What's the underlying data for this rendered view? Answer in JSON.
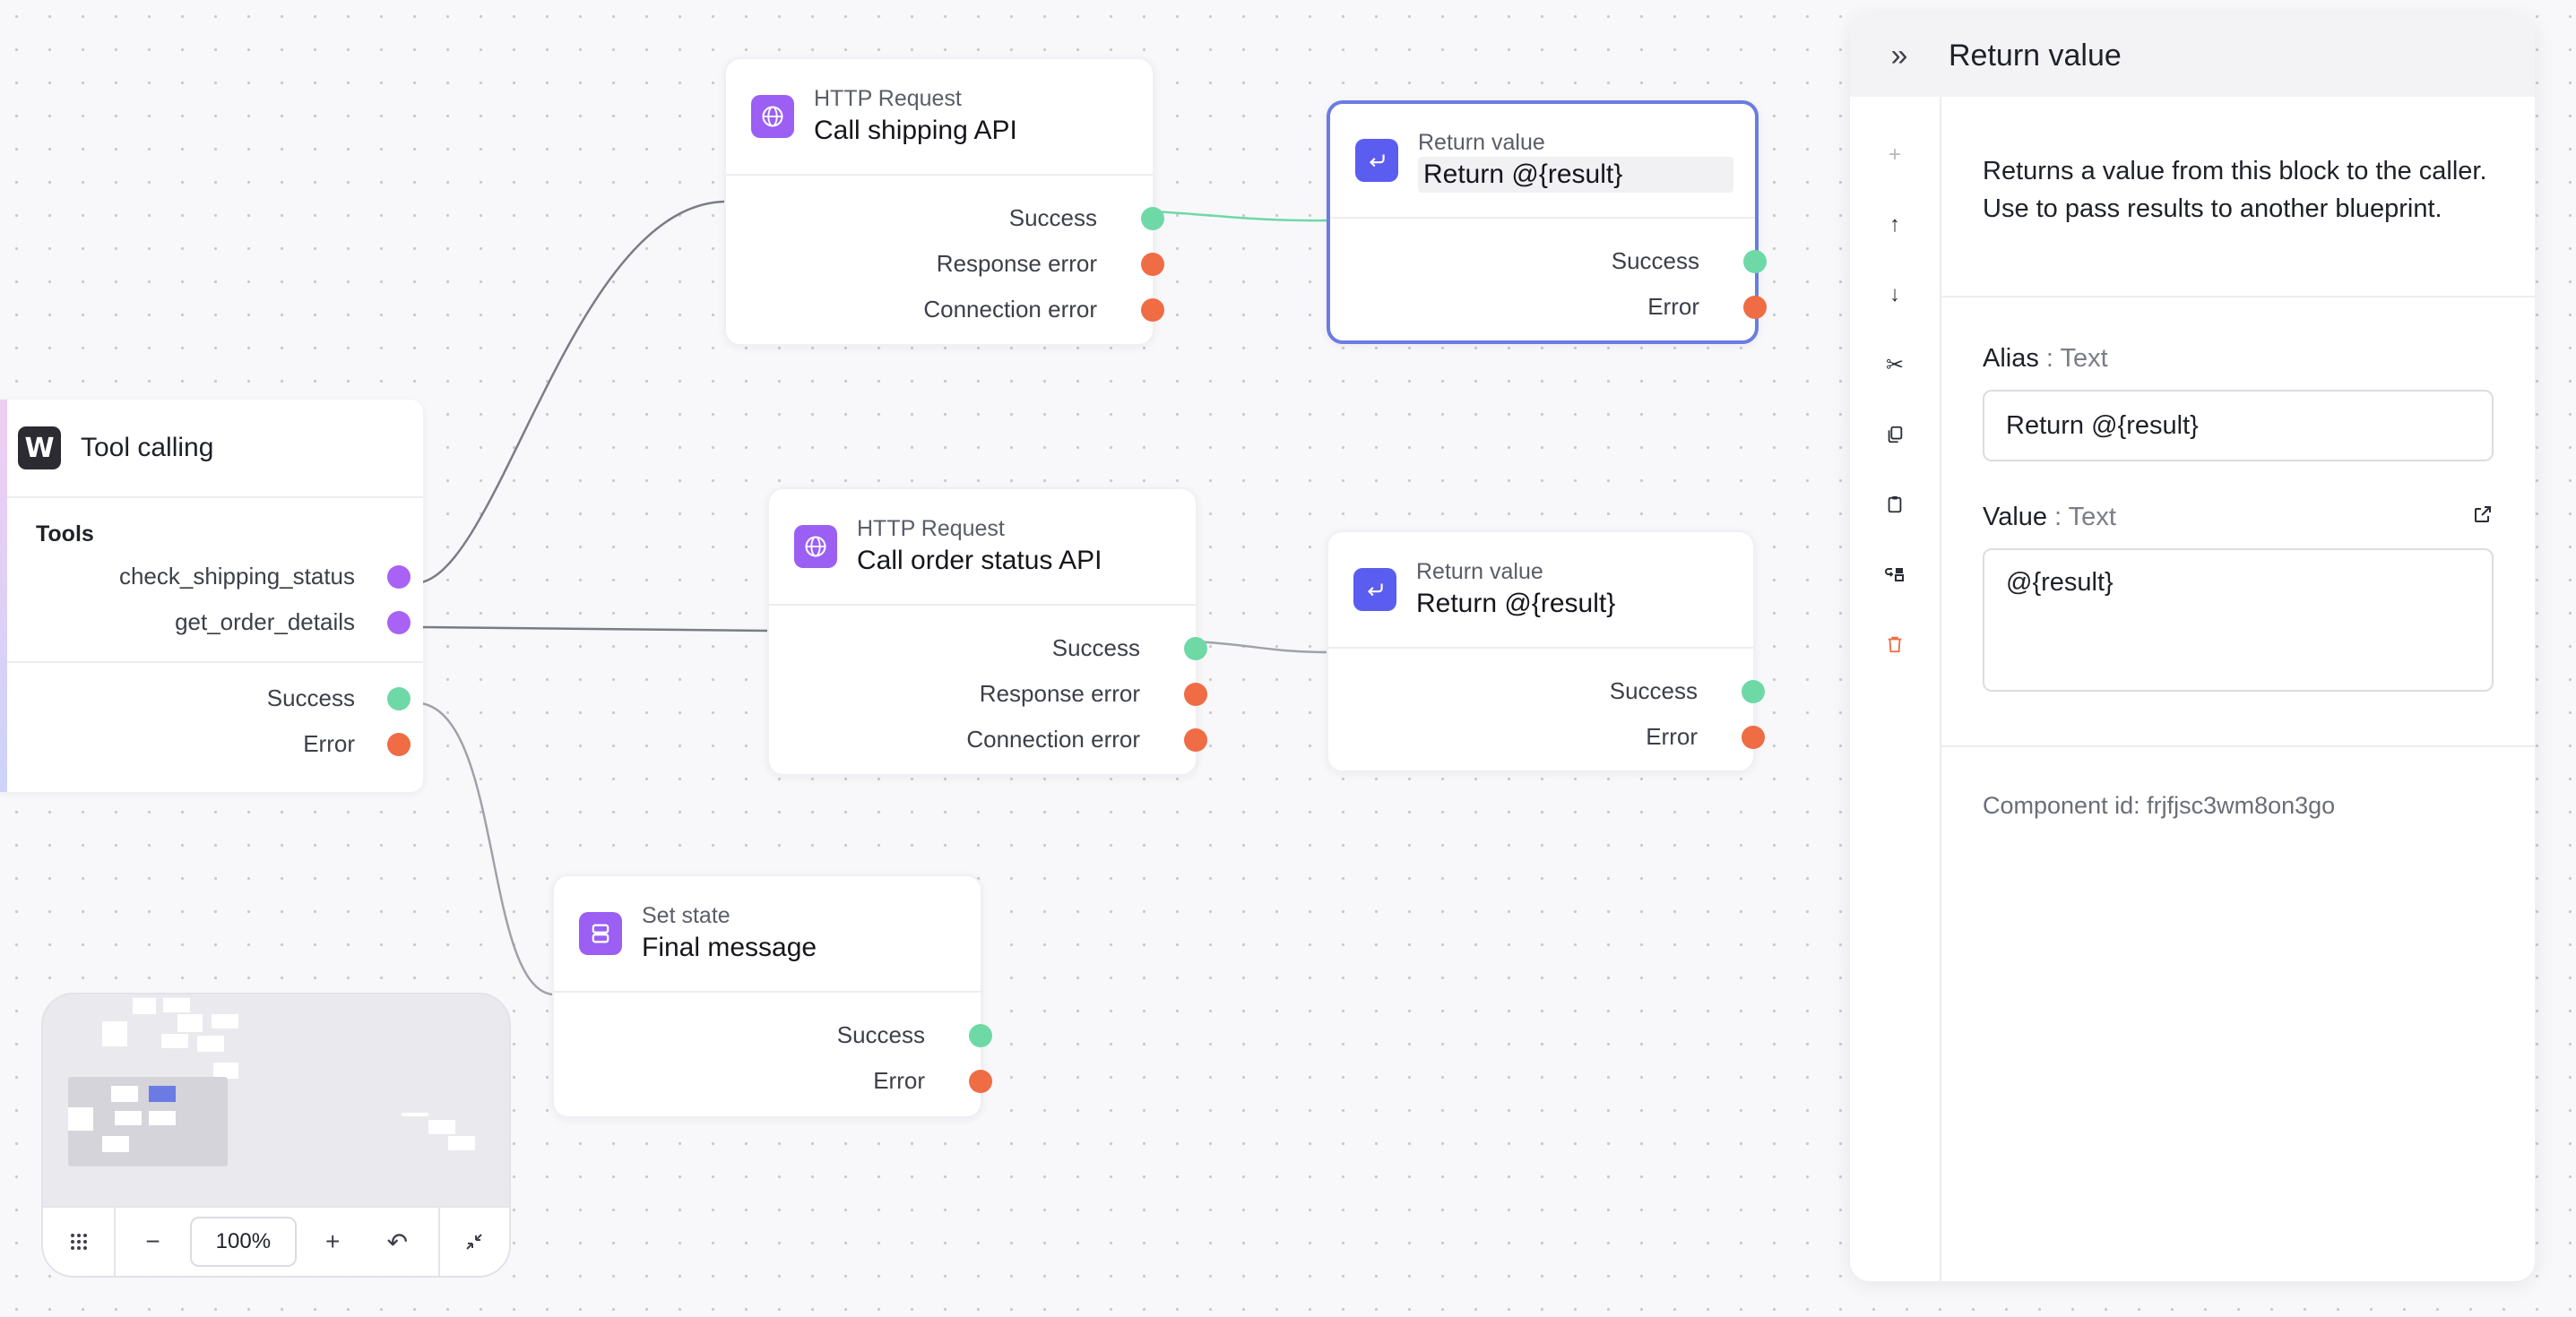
{
  "colors": {
    "success": "#6ed9a6",
    "error": "#ef6c44",
    "tool": "#a862f5",
    "accent": "#6b7be4"
  },
  "tool_node": {
    "icon": "w-logo-icon",
    "title": "Tool calling",
    "section": "Tools",
    "tools": [
      "check_shipping_status",
      "get_order_details"
    ],
    "outputs": [
      "Success",
      "Error"
    ]
  },
  "http1": {
    "type": "HTTP Request",
    "name": "Call shipping API",
    "icon": "globe-icon",
    "outputs": [
      "Success",
      "Response error",
      "Connection error"
    ]
  },
  "http2": {
    "type": "HTTP Request",
    "name": "Call order status API",
    "icon": "globe-icon",
    "outputs": [
      "Success",
      "Response error",
      "Connection error"
    ]
  },
  "ret1": {
    "type": "Return value",
    "name": "Return @{result}",
    "icon": "return-icon",
    "outputs": [
      "Success",
      "Error"
    ]
  },
  "ret2": {
    "type": "Return value",
    "name": "Return @{result}",
    "icon": "return-icon",
    "outputs": [
      "Success",
      "Error"
    ]
  },
  "setstate": {
    "type": "Set state",
    "name": "Final message",
    "icon": "set-state-icon",
    "outputs": [
      "Success",
      "Error"
    ]
  },
  "minimap": {
    "zoom": "100%"
  },
  "panel": {
    "title": "Return value",
    "description": "Returns a value from this block to the caller. Use to pass results to another blueprint.",
    "alias_label": "Alias",
    "alias_type": ": Text",
    "alias_value": "Return @{result}",
    "value_label": "Value",
    "value_type": ": Text",
    "value_value": "@{result}",
    "component_id": "Component id: frjfjsc3wm8on3go"
  }
}
